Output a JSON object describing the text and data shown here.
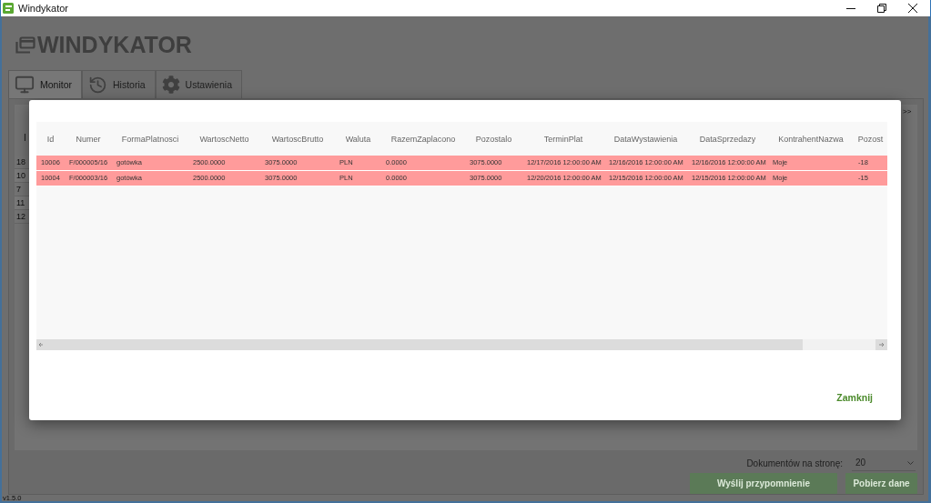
{
  "window": {
    "title": "Windykator"
  },
  "app": {
    "logo_text": "WINDYKATOR",
    "version": "v1.5.0"
  },
  "tabs": [
    {
      "label": "Monitor",
      "kind": "monitor",
      "selected": true
    },
    {
      "label": "Historia",
      "kind": "history",
      "selected": false
    },
    {
      "label": "Ustawienia",
      "kind": "settings",
      "selected": false
    }
  ],
  "background_table": {
    "column_1": "I",
    "rows": [
      "18",
      "10",
      "7",
      "11",
      "12"
    ],
    "pager": ">>"
  },
  "footer": {
    "page_size_label": "Dokumentów na stronę:",
    "page_size": "20",
    "buttons": [
      "Wyślij przypomnienie",
      "Pobierz dane"
    ]
  },
  "dialog": {
    "table": {
      "columns": [
        "Id",
        "Numer",
        "FormaPlatnosci",
        "WartoscNetto",
        "WartoscBrutto",
        "Waluta",
        "RazemZaplacono",
        "Pozostalo",
        "TerminPlat",
        "DataWystawienia",
        "DataSprzedazy",
        "KontrahentNazwa",
        "Pozost"
      ],
      "rows": [
        {
          "highlighted": true,
          "cells": [
            "10006",
            "F/000005/16",
            "gotówka",
            "2500.0000",
            "3075.0000",
            "PLN",
            "0.0000",
            "3075.0000",
            "12/17/2016 12:00:00 AM",
            "12/16/2016 12:00:00 AM",
            "12/16/2016 12:00:00 AM",
            "Moje",
            "-18"
          ]
        },
        {
          "highlighted": true,
          "cells": [
            "10004",
            "F/000003/16",
            "gotówka",
            "2500.0000",
            "3075.0000",
            "PLN",
            "0.0000",
            "3075.0000",
            "12/20/2016 12:00:00 AM",
            "12/15/2016 12:00:00 AM",
            "12/15/2016 12:00:00 AM",
            "Moje",
            "-15"
          ]
        }
      ]
    },
    "close_button": "Zamknij"
  }
}
